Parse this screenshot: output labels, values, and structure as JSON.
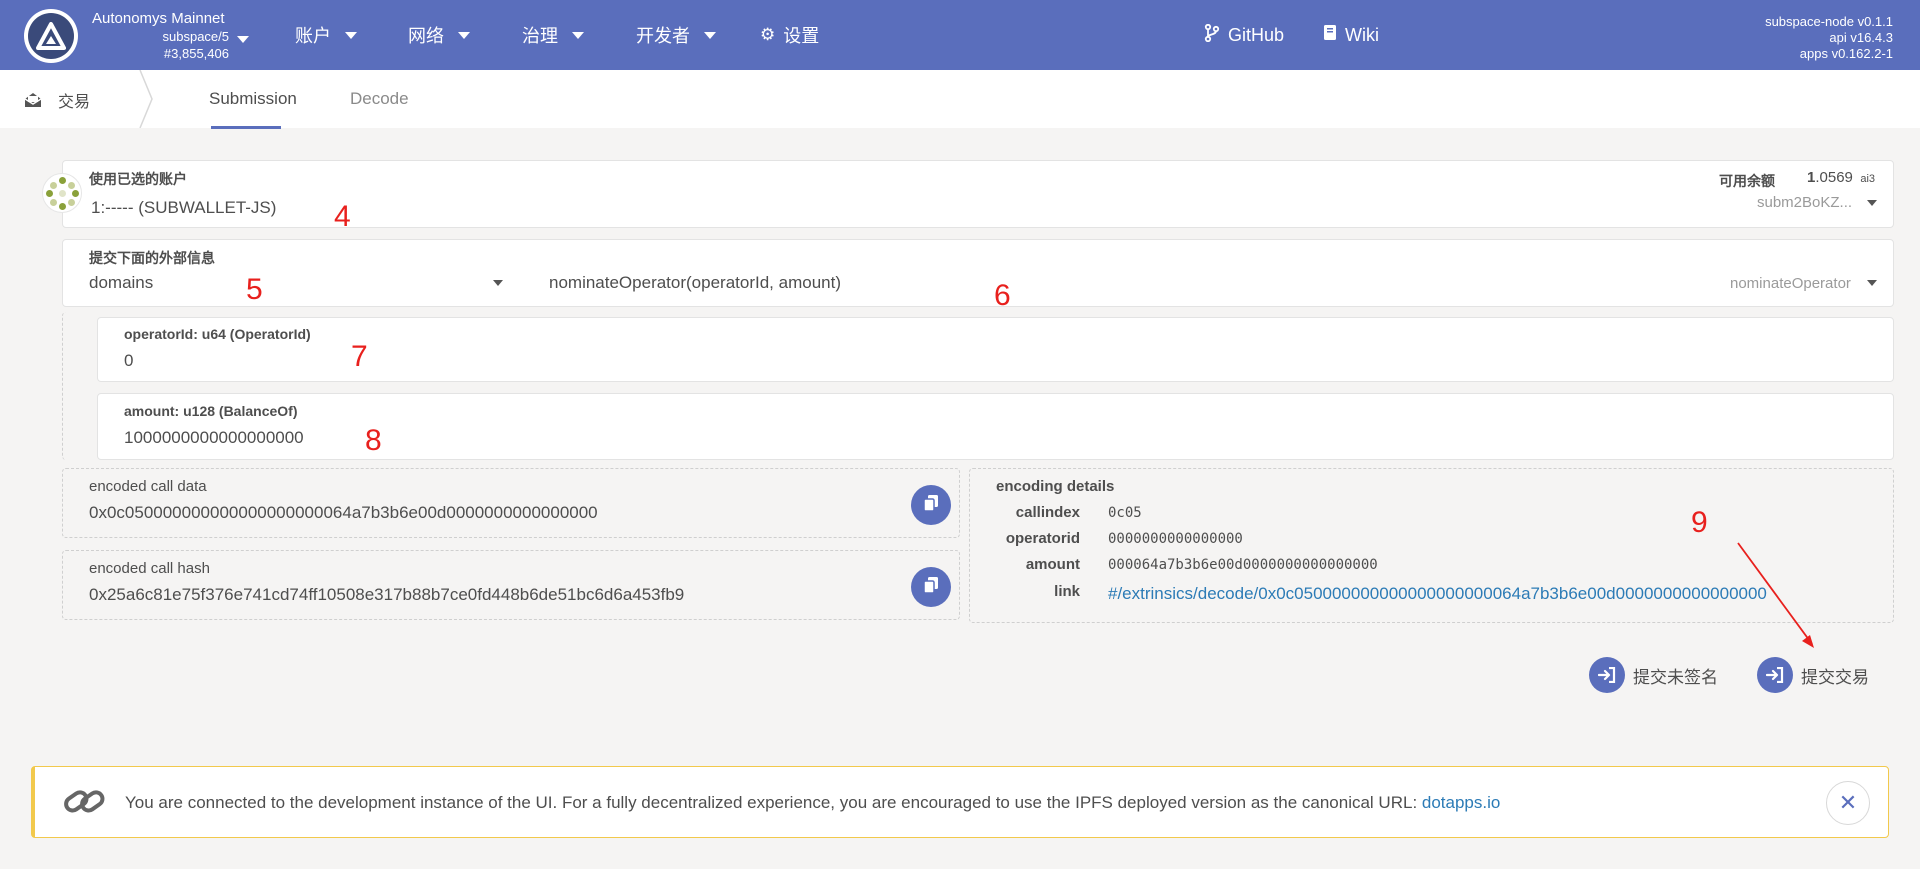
{
  "topbar": {
    "chain_name": "Autonomys Mainnet",
    "chain_spec": "subspace/5",
    "block_number": "#3,855,406",
    "nav": [
      {
        "label": "账户"
      },
      {
        "label": "网络"
      },
      {
        "label": "治理"
      },
      {
        "label": "开发者"
      },
      {
        "label": "设置"
      }
    ],
    "github_label": "GitHub",
    "wiki_label": "Wiki",
    "versions": [
      "subspace-node v0.1.1",
      "api v16.4.3",
      "apps v0.162.2-1"
    ]
  },
  "subbar": {
    "section_label": "交易",
    "tabs": [
      {
        "label": "Submission",
        "active": true
      },
      {
        "label": "Decode",
        "active": false
      }
    ]
  },
  "account": {
    "label": "使用已选的账户",
    "value": "1:----- (SUBWALLET-JS)",
    "balance_label": "可用余额",
    "balance_int": "1",
    "balance_dec": ".0569",
    "balance_unit": "ai3",
    "address_short": "subm2BoKZ..."
  },
  "extrinsic": {
    "label": "提交下面的外部信息",
    "pallet": "domains",
    "call": "nominateOperator(operatorId, amount)",
    "call_short": "nominateOperator"
  },
  "params": [
    {
      "label": "operatorId: u64 (OperatorId)",
      "value": "0"
    },
    {
      "label": "amount: u128 (BalanceOf)",
      "value": "1000000000000000000"
    }
  ],
  "encoded": {
    "call_data_label": "encoded call data",
    "call_data": "0x0c050000000000000000000064a7b3b6e00d0000000000000000",
    "call_hash_label": "encoded call hash",
    "call_hash": "0x25a6c81e75f376e741cd74ff10508e317b88b7ce0fd448b6de51bc6d6a453fb9"
  },
  "details": {
    "title": "encoding details",
    "rows": [
      {
        "key": "callindex",
        "value": "0c05"
      },
      {
        "key": "operatorid",
        "value": "0000000000000000"
      },
      {
        "key": "amount",
        "value": "000064a7b3b6e00d0000000000000000"
      }
    ],
    "link_key": "link",
    "link_value": "#/extrinsics/decode/0x0c050000000000000000000064a7b3b6e00d0000000000000000"
  },
  "actions": {
    "unsigned_label": "提交未签名",
    "submit_label": "提交交易"
  },
  "annotations": [
    "4",
    "5",
    "6",
    "7",
    "8",
    "9"
  ],
  "notice": {
    "text": "You are connected to the development instance of the UI. For a fully decentralized experience, you are encouraged to use the IPFS deployed version as the canonical URL: ",
    "link": "dotapps.io"
  },
  "colors": {
    "brand": "#5a6ebc",
    "annotation": "#e8201d",
    "link": "#2c7bb6",
    "notice_border": "#f2c94c"
  }
}
